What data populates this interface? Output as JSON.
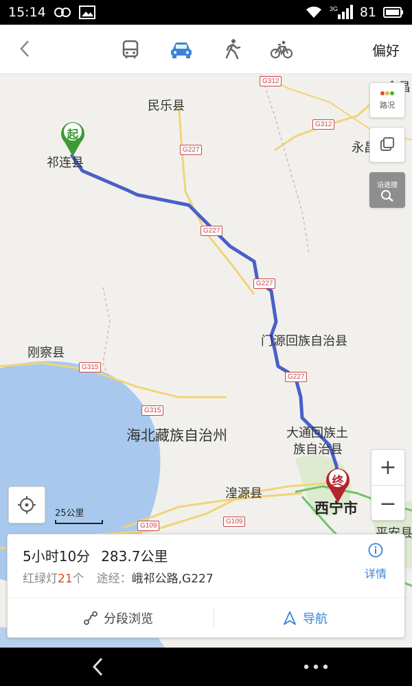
{
  "status": {
    "time": "15:14",
    "signal_label": "3G",
    "battery": "81"
  },
  "topnav": {
    "back_icon": "chevron-left-icon",
    "modes": [
      {
        "name": "bus",
        "icon": "bus-icon",
        "active": false
      },
      {
        "name": "car",
        "icon": "car-icon",
        "active": true
      },
      {
        "name": "walk",
        "icon": "walk-icon",
        "active": false
      },
      {
        "name": "bike",
        "icon": "bike-icon",
        "active": false
      }
    ],
    "preference_label": "偏好"
  },
  "map": {
    "places": {
      "minle": "民乐县",
      "qilian": "祁连县",
      "yongchang": "永昌",
      "jinchang": "金昌",
      "menyuan": "门源回族自治县",
      "gangcha": "刚察县",
      "haibei": "海北藏族自治州",
      "datong_1": "大通回族土",
      "datong_2": "族自治县",
      "huangyuan": "湟源县",
      "xining": "西宁市",
      "pingan": "平安县"
    },
    "road_labels": {
      "g312_a": "G312",
      "g312_b": "G312",
      "g227_a": "G227",
      "g227_b": "G227",
      "g227_c": "G227",
      "g227_d": "G227",
      "g315_a": "G315",
      "g315_b": "G315",
      "g109_a": "G109",
      "g109_b": "G109"
    },
    "start_marker_label": "起",
    "end_marker_label": "终",
    "route_color": "#4a5fc8",
    "start_color": "#3d9b34",
    "end_color": "#b5232b",
    "controls": {
      "traffic_label": "路况",
      "along_label": "沿途搜",
      "zoom_in": "+",
      "zoom_out": "−"
    },
    "scale_label": "25公里"
  },
  "route": {
    "duration": "5小时10分",
    "distance": "283.7公里",
    "traffic_lights_prefix": "红绿灯",
    "traffic_lights_count": "21",
    "traffic_lights_suffix": "个",
    "via_prefix": "途经：",
    "via_roads": "峨祁公路,G227",
    "details_label": "详情",
    "segment_browse_label": "分段浏览",
    "navigate_label": "导航"
  },
  "accent_color": "#3a83d5"
}
